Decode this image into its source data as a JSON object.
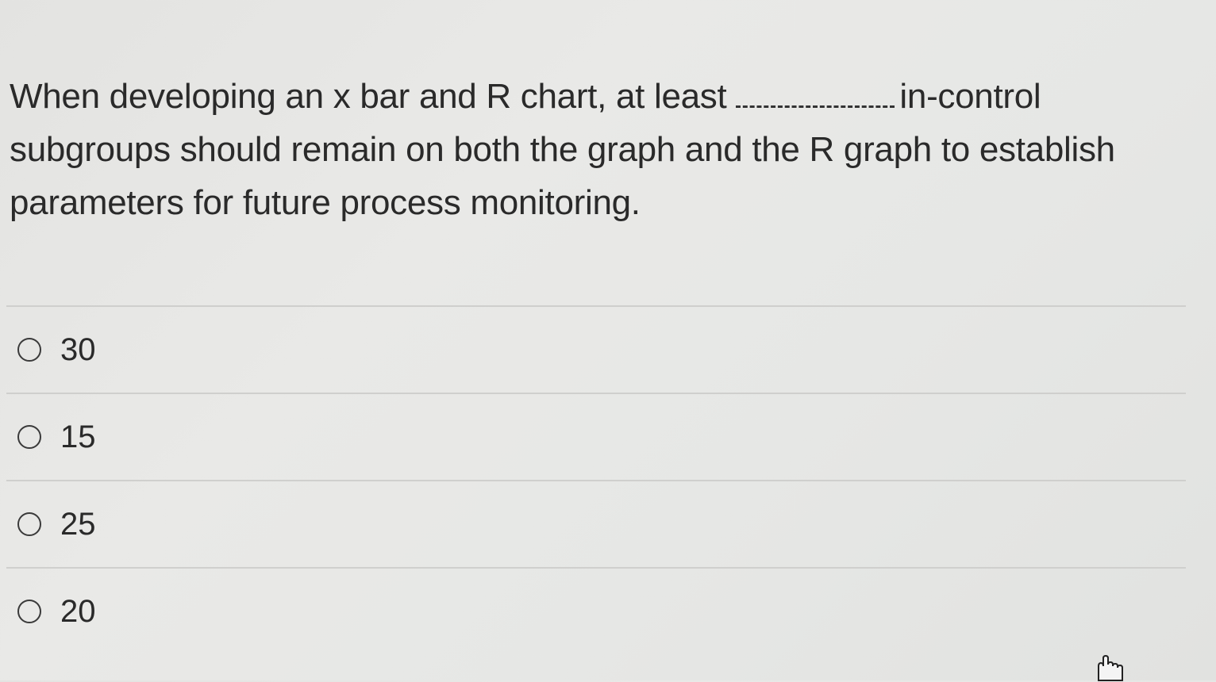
{
  "question": {
    "text_before_blank": "When developing an x bar and R chart, at least",
    "text_after_blank": "in-control subgroups should remain on both the graph and the R graph to establish parameters for future process monitoring."
  },
  "options": [
    {
      "label": "30",
      "selected": false
    },
    {
      "label": "15",
      "selected": false
    },
    {
      "label": "25",
      "selected": false
    },
    {
      "label": "20",
      "selected": false
    }
  ],
  "cursor": {
    "icon": "hand-pointer-icon"
  }
}
